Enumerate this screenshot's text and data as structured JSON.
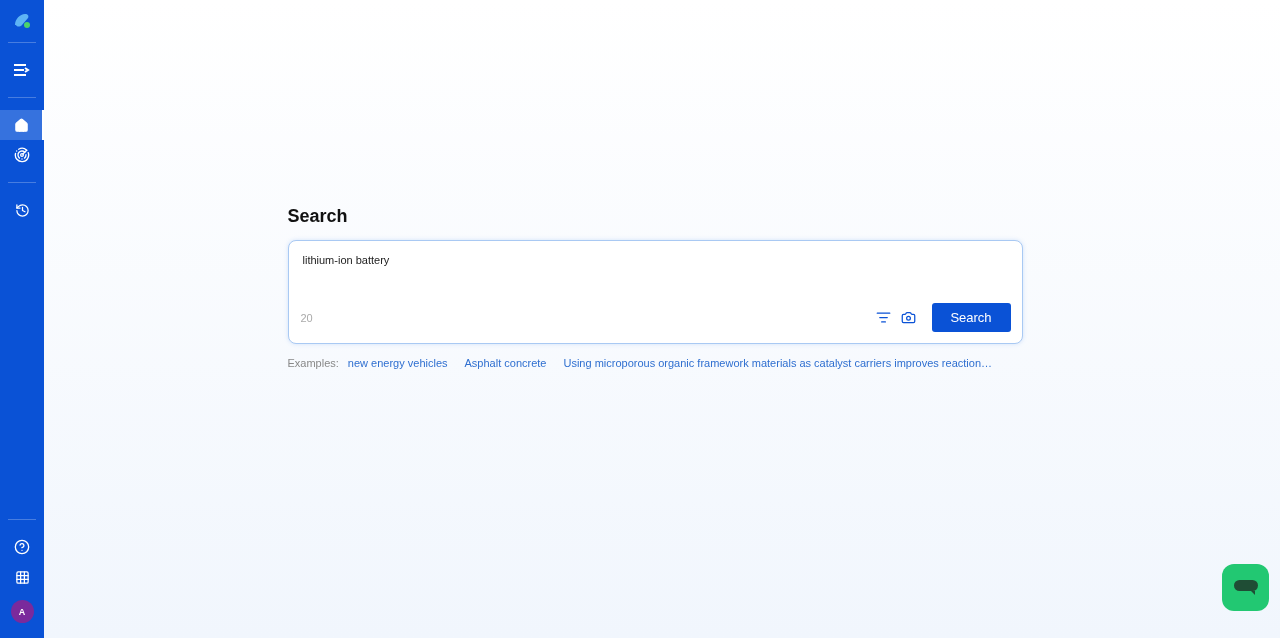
{
  "sidebar": {
    "nav": [
      {
        "kind": "menu",
        "selected": false
      },
      {
        "kind": "home",
        "selected": true
      },
      {
        "kind": "signal",
        "selected": false
      },
      {
        "kind": "history",
        "selected": false
      }
    ],
    "avatar": "A"
  },
  "search": {
    "title": "Search",
    "value": "lithium-ion battery",
    "count": "20",
    "button": "Search"
  },
  "examples": {
    "label": "Examples:",
    "items": [
      "new energy vehicles",
      "Asphalt concrete",
      "Using microporous organic framework materials as catalyst carriers improves reaction…"
    ]
  }
}
